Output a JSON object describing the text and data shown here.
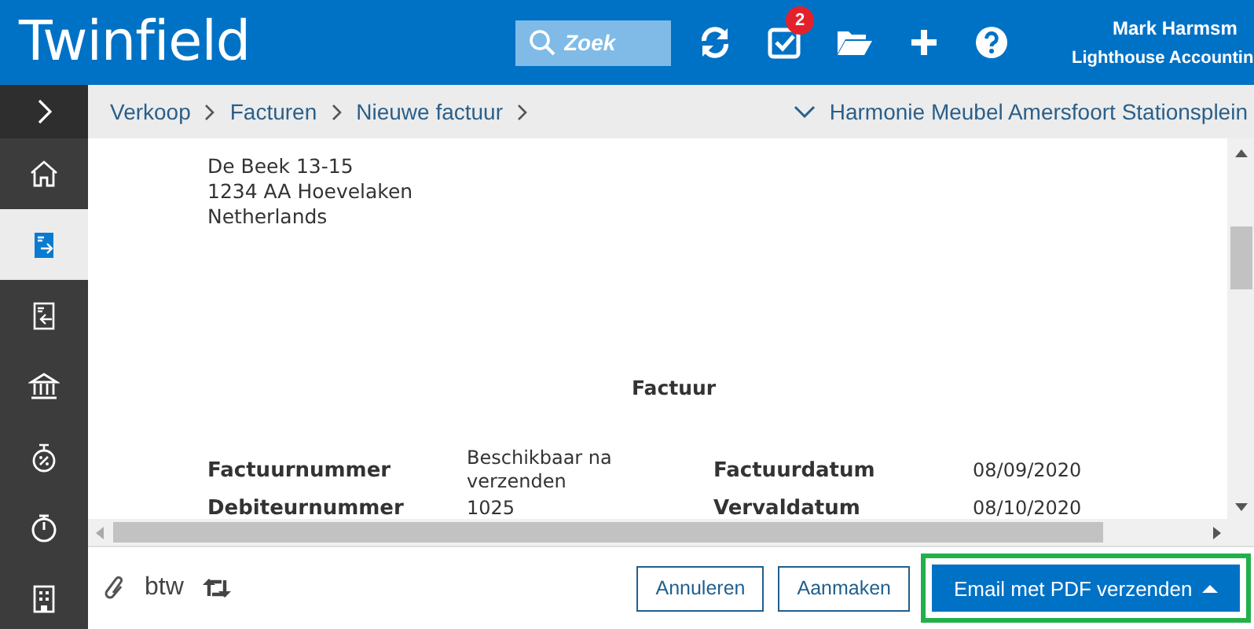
{
  "header": {
    "logo": "Twinfield",
    "search": {
      "placeholder": "Zoek"
    },
    "tasks_badge": "2",
    "user": {
      "name": "Mark Harmsm",
      "company": "Lighthouse Accountin"
    }
  },
  "sidebar": {
    "expanded": false,
    "items": [
      {
        "kind": "home",
        "selected": false
      },
      {
        "kind": "sales",
        "selected": true
      },
      {
        "kind": "purchase",
        "selected": false
      },
      {
        "kind": "bank",
        "selected": false
      },
      {
        "kind": "discount",
        "selected": false
      },
      {
        "kind": "timer",
        "selected": false
      },
      {
        "kind": "building",
        "selected": false
      }
    ]
  },
  "breadcrumb": [
    "Verkoop",
    "Facturen",
    "Nieuwe factuur"
  ],
  "administration": "Harmonie Meubel Amersfoort Stationsplein",
  "document": {
    "address": [
      "De Beek 13-15",
      "1234 AA Hoevelaken",
      "Netherlands"
    ],
    "title": "Factuur",
    "rows": [
      {
        "left_label": "Factuurnummer",
        "left_value": "Beschikbaar na verzenden",
        "right_label": "Factuurdatum",
        "right_value": "08/09/2020"
      },
      {
        "left_label": "Debiteurnummer",
        "left_value": "1025",
        "right_label": "Vervaldatum",
        "right_value": "08/10/2020"
      }
    ]
  },
  "footer": {
    "vat_label": "btw",
    "buttons": [
      {
        "label": "Annuleren",
        "kind": "secondary",
        "highlighted": false
      },
      {
        "label": "Aanmaken",
        "kind": "secondary",
        "highlighted": false
      },
      {
        "label": "Email met PDF verzenden",
        "kind": "primary",
        "highlighted": true
      }
    ]
  }
}
